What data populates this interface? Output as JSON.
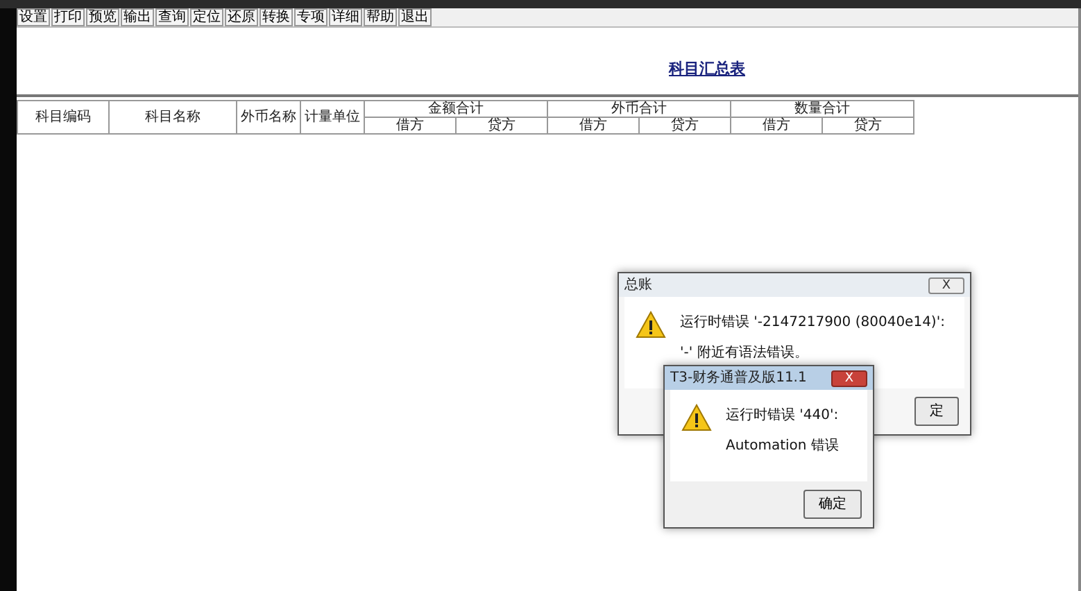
{
  "toolbar": [
    {
      "label": "设置"
    },
    {
      "label": "打印"
    },
    {
      "label": "预览"
    },
    {
      "label": "输出"
    },
    {
      "label": "查询"
    },
    {
      "label": "定位"
    },
    {
      "label": "还原"
    },
    {
      "label": "转换"
    },
    {
      "label": "专项"
    },
    {
      "label": "详细"
    },
    {
      "label": "帮助"
    },
    {
      "label": "退出"
    }
  ],
  "report": {
    "title": "科目汇总表",
    "columns": [
      {
        "label": "科目编码"
      },
      {
        "label": "科目名称"
      },
      {
        "label": "外币名称"
      },
      {
        "label": "计量单位"
      },
      {
        "label": "金额合计",
        "children": [
          "借方",
          "贷方"
        ]
      },
      {
        "label": "外币合计",
        "children": [
          "借方",
          "贷方"
        ]
      },
      {
        "label": "数量合计",
        "children": [
          "借方",
          "贷方"
        ]
      }
    ]
  },
  "dialogs": [
    {
      "title": "总账",
      "active": false,
      "close": "X",
      "messages": [
        "运行时错误 '-2147217900 (80040e14)':",
        "'-' 附近有语法错误。"
      ],
      "button": "定"
    },
    {
      "title": "T3-财务通普及版11.1",
      "active": true,
      "close": "X",
      "messages": [
        "运行时错误 '440':",
        "Automation 错误"
      ],
      "button": "确定"
    }
  ]
}
